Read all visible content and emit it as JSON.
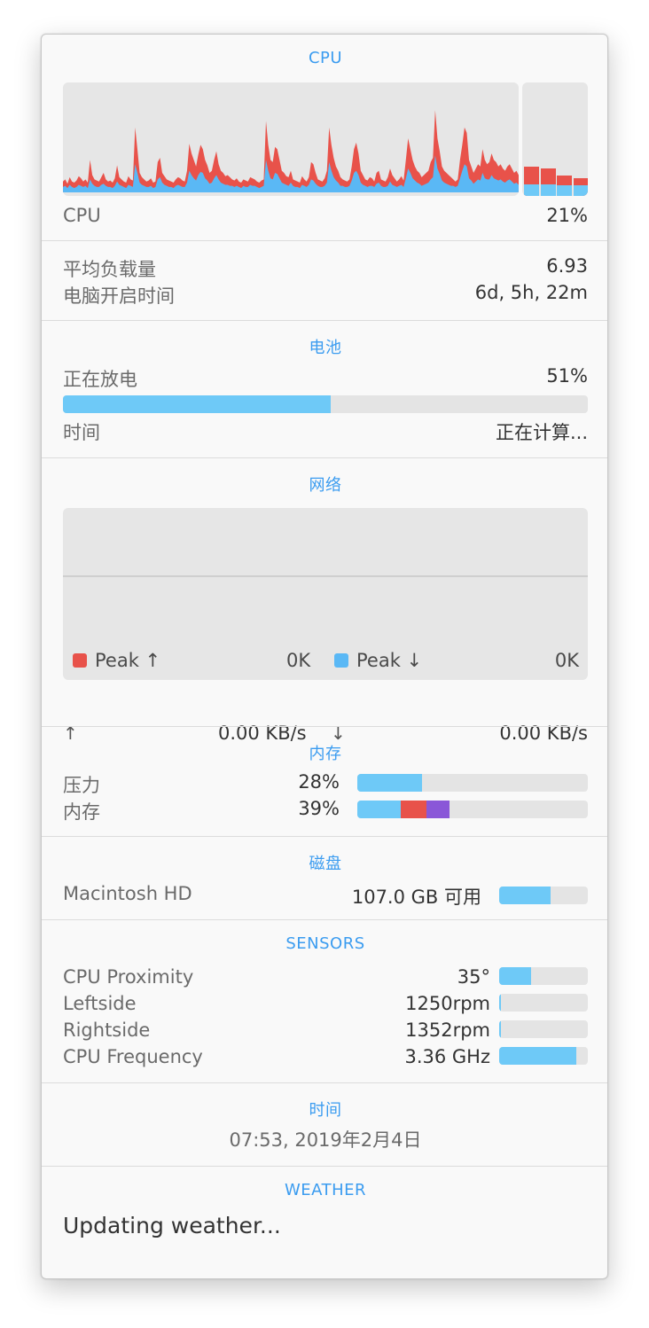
{
  "cpu": {
    "title": "CPU",
    "label": "CPU",
    "value": "21%",
    "history_red": [
      10,
      12,
      8,
      14,
      10,
      9,
      11,
      15,
      13,
      10,
      12,
      9,
      30,
      16,
      12,
      11,
      10,
      14,
      18,
      12,
      10,
      11,
      9,
      13,
      25,
      14,
      12,
      10,
      9,
      15,
      12,
      11,
      60,
      40,
      18,
      14,
      12,
      10,
      11,
      13,
      9,
      10,
      28,
      32,
      18,
      15,
      12,
      11,
      10,
      9,
      12,
      14,
      13,
      11,
      10,
      20,
      45,
      36,
      30,
      24,
      35,
      44,
      40,
      30,
      25,
      18,
      20,
      30,
      38,
      26,
      20,
      18,
      15,
      16,
      14,
      12,
      11,
      13,
      10,
      9,
      12,
      11,
      10,
      14,
      13,
      12,
      10,
      9,
      11,
      12,
      66,
      44,
      30,
      28,
      42,
      40,
      30,
      20,
      18,
      15,
      14,
      20,
      12,
      11,
      10,
      9,
      15,
      12,
      10,
      14,
      28,
      26,
      18,
      12,
      11,
      10,
      13,
      20,
      60,
      44,
      32,
      24,
      20,
      14,
      12,
      11,
      10,
      12,
      24,
      40,
      46,
      36,
      20,
      16,
      12,
      11,
      14,
      13,
      10,
      18,
      20,
      12,
      11,
      10,
      14,
      22,
      16,
      13,
      10,
      12,
      15,
      11,
      30,
      50,
      40,
      30,
      24,
      20,
      18,
      14,
      16,
      18,
      20,
      28,
      32,
      76,
      50,
      38,
      24,
      20,
      18,
      16,
      14,
      12,
      10,
      12,
      30,
      44,
      60,
      55,
      30,
      24,
      18,
      22,
      26,
      24,
      40,
      30,
      26,
      28,
      36,
      30,
      28,
      24,
      26,
      22,
      20,
      24,
      26,
      22,
      18,
      20,
      16
    ],
    "history_blue": [
      5,
      6,
      4,
      7,
      5,
      4,
      5,
      7,
      6,
      5,
      6,
      4,
      12,
      8,
      6,
      5,
      5,
      7,
      8,
      6,
      5,
      5,
      4,
      6,
      10,
      7,
      6,
      5,
      4,
      7,
      6,
      5,
      26,
      18,
      9,
      7,
      6,
      5,
      5,
      6,
      4,
      5,
      12,
      14,
      9,
      7,
      6,
      5,
      5,
      4,
      6,
      7,
      6,
      5,
      5,
      9,
      20,
      16,
      13,
      11,
      16,
      19,
      18,
      13,
      11,
      8,
      9,
      13,
      16,
      12,
      9,
      8,
      7,
      7,
      6,
      6,
      5,
      6,
      5,
      4,
      6,
      5,
      5,
      7,
      6,
      6,
      5,
      4,
      5,
      6,
      30,
      20,
      13,
      12,
      18,
      17,
      13,
      9,
      8,
      7,
      6,
      9,
      6,
      5,
      5,
      4,
      7,
      6,
      5,
      7,
      12,
      11,
      8,
      6,
      5,
      5,
      6,
      9,
      28,
      20,
      14,
      11,
      9,
      6,
      6,
      5,
      5,
      6,
      11,
      18,
      20,
      16,
      9,
      7,
      6,
      5,
      6,
      6,
      5,
      8,
      9,
      6,
      5,
      5,
      6,
      10,
      7,
      6,
      5,
      6,
      7,
      5,
      13,
      22,
      18,
      13,
      11,
      9,
      8,
      6,
      7,
      8,
      9,
      12,
      14,
      34,
      22,
      17,
      11,
      9,
      8,
      7,
      6,
      6,
      5,
      6,
      13,
      20,
      26,
      24,
      13,
      11,
      8,
      10,
      12,
      11,
      18,
      13,
      12,
      12,
      16,
      13,
      12,
      11,
      12,
      10,
      9,
      11,
      12,
      10,
      8,
      9,
      7
    ],
    "cores": [
      {
        "total": 26,
        "user": 10
      },
      {
        "total": 24,
        "user": 10
      },
      {
        "total": 18,
        "user": 9
      },
      {
        "total": 16,
        "user": 9
      }
    ]
  },
  "system": {
    "load_label": "平均负载量",
    "load_value": "6.93",
    "uptime_label": "电脑开启时间",
    "uptime_value": "6d, 5h, 22m"
  },
  "battery": {
    "title": "电池",
    "status_label": "正在放电",
    "percent": "51%",
    "level": 0.51,
    "time_label": "时间",
    "time_value": "正在计算..."
  },
  "network": {
    "title": "网络",
    "peak_up_label": "Peak ↑",
    "peak_up_value": "0K",
    "peak_down_label": "Peak ↓",
    "peak_down_value": "0K",
    "up_arrow": "↑",
    "up_rate": "0.00 KB/s",
    "down_arrow": "↓",
    "down_rate": "0.00 KB/s",
    "up_color": "#e8524a",
    "down_color": "#5ab8f5"
  },
  "memory": {
    "title": "内存",
    "pressure_label": "压力",
    "pressure_value": "28%",
    "pressure_level": 0.28,
    "mem_label": "内存",
    "mem_value": "39%",
    "mem_segments": [
      0.19,
      0.11,
      0.1
    ]
  },
  "disk": {
    "title": "磁盘",
    "name": "Macintosh HD",
    "free": "107.0 GB 可用",
    "used_level": 0.58
  },
  "sensors": {
    "title": "SENSORS",
    "items": [
      {
        "label": "CPU Proximity",
        "value": "35°",
        "level": 0.36
      },
      {
        "label": "Leftside",
        "value": "1250rpm",
        "level": 0.02
      },
      {
        "label": "Rightside",
        "value": "1352rpm",
        "level": 0.02
      },
      {
        "label": "CPU Frequency",
        "value": "3.36 GHz",
        "level": 0.87
      }
    ]
  },
  "time": {
    "title": "时间",
    "value": "07:53, 2019年2月4日"
  },
  "weather": {
    "title": "WEATHER",
    "status": "Updating weather..."
  },
  "colors": {
    "accent": "#3b9cf0",
    "bar_blue": "#6ec9f7",
    "bar_red": "#e8524a",
    "bar_purple": "#8a57d8"
  }
}
